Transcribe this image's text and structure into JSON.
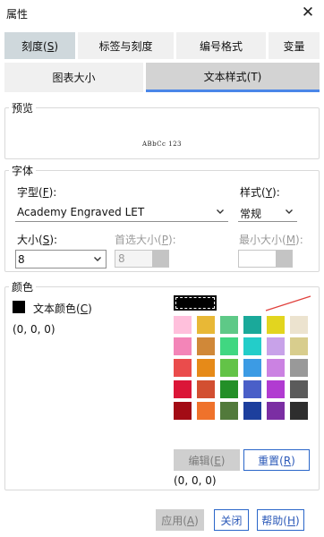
{
  "window": {
    "title": "属性"
  },
  "tabs_row1": [
    {
      "label": "刻度(",
      "key": "S",
      "suffix": ")"
    },
    {
      "label": "标签与刻度",
      "key": "",
      "suffix": ""
    },
    {
      "label": "编号格式",
      "key": "",
      "suffix": ""
    },
    {
      "label": "变量",
      "key": "",
      "suffix": ""
    }
  ],
  "tabs_row2": [
    {
      "label": "图表大小"
    },
    {
      "label": "文本样式(T)"
    }
  ],
  "preview": {
    "legend": "预览",
    "sample": "ABbCc 123"
  },
  "font": {
    "legend": "字体",
    "typeface_label": "字型(",
    "typeface_key": "F",
    "typeface_suffix": "):",
    "typeface_value": "Academy Engraved LET",
    "style_label": "样式(",
    "style_key": "Y",
    "style_suffix": "):",
    "style_value": "常规",
    "size_label": "大小(",
    "size_key": "S",
    "size_suffix": "):",
    "size_value": "8",
    "pref_size_label": "首选大小(",
    "pref_size_key": "P",
    "pref_size_suffix": "):",
    "pref_size_value": "8",
    "min_size_label": "最小大小(",
    "min_size_key": "M",
    "min_size_suffix": "):"
  },
  "color": {
    "legend": "颜色",
    "text_color_label": "文本颜色(",
    "text_color_key": "C",
    "text_color_suffix": ")",
    "text_color_value": "(0, 0, 0)",
    "selected_value": "(0, 0, 0)",
    "edit_label": "编辑(",
    "edit_key": "E",
    "edit_suffix": ")",
    "reset_label": "重置(",
    "reset_key": "R",
    "reset_suffix": ")",
    "current_color": "#000000",
    "palette": [
      "#ffc0dc",
      "#e8b836",
      "#5ec987",
      "#1aa99a",
      "#e2d51f",
      "#ece3cf",
      "#f385b8",
      "#d08838",
      "#40d781",
      "#23cdc9",
      "#c8a2e9",
      "#d8cd8d",
      "#ea4c4c",
      "#e68a18",
      "#63c347",
      "#3c9be4",
      "#cb82e2",
      "#999999",
      "#db1638",
      "#d24f31",
      "#238f28",
      "#4a5fc8",
      "#b13bd1",
      "#5b5b5b",
      "#a30c15",
      "#ef722b",
      "#527a3b",
      "#1d3f9d",
      "#7b2ea3",
      "#2e2e2e"
    ]
  },
  "footer": {
    "apply_label": "应用(",
    "apply_key": "A",
    "apply_suffix": ")",
    "close_label": "关闭",
    "help_label": "帮助(",
    "help_key": "H",
    "help_suffix": ")"
  }
}
